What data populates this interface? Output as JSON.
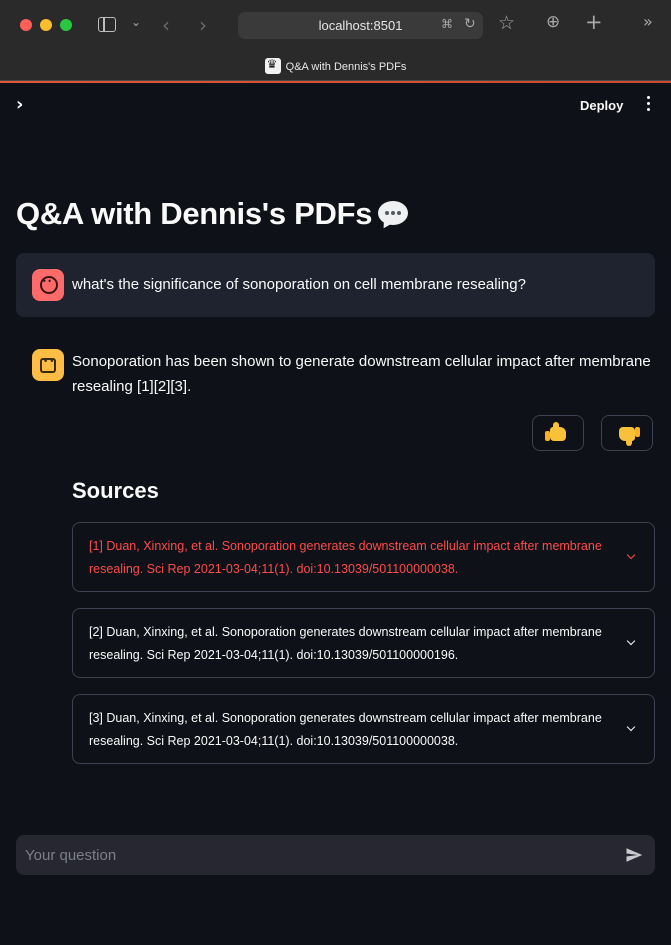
{
  "browser": {
    "url": "localhost:8501",
    "tab_title": "Q&A with Dennis's PDFs"
  },
  "header": {
    "deploy_label": "Deploy"
  },
  "page": {
    "title": "Q&A with Dennis's PDFs",
    "title_icon": "speech-balloon-icon"
  },
  "chat": {
    "user_message": "what's the significance of sonoporation on cell membrane resealing?",
    "assistant_message": "Sonoporation has been shown to generate downstream cellular impact after membrane resealing [1][2][3].",
    "feedback": {
      "thumbs_up_icon": "thumbs-up-icon",
      "thumbs_down_icon": "thumbs-down-icon"
    },
    "sources_heading": "Sources",
    "sources": [
      {
        "label": "[1] Duan, Xinxing, et al. Sonoporation generates downstream cellular impact after membrane resealing. Sci Rep 2021-03-04;11(1). doi:10.13039/501100000038.",
        "active": true
      },
      {
        "label": "[2] Duan, Xinxing, et al. Sonoporation generates downstream cellular impact after membrane resealing. Sci Rep 2021-03-04;11(1). doi:10.13039/501100000196.",
        "active": false
      },
      {
        "label": "[3] Duan, Xinxing, et al. Sonoporation generates downstream cellular impact after membrane resealing. Sci Rep 2021-03-04;11(1). doi:10.13039/501100000038.",
        "active": false
      }
    ]
  },
  "input": {
    "placeholder": "Your question",
    "value": ""
  },
  "colors": {
    "background": "#0e1117",
    "accent": "#ff4b4b",
    "user_avatar": "#ff6b6b",
    "assistant_avatar": "#ffbd45"
  }
}
